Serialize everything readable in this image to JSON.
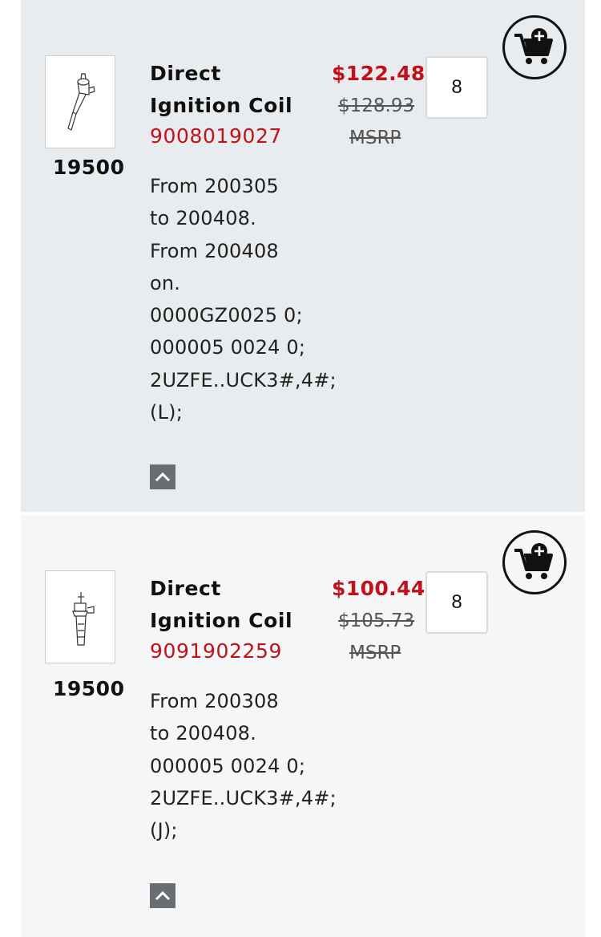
{
  "products": [
    {
      "callout": "19500",
      "name": "Direct Ignition Coil",
      "part_number": "9008019027",
      "price": "$122.48",
      "msrp_price": "$128.93",
      "msrp_label": "MSRP",
      "quantity": "8",
      "notes": [
        "From 200305",
        "to 200408.",
        "From 200408",
        "on.",
        "0000GZ0025 0;",
        "000005 0024 0;",
        "2UZFE..UCK3#,4#;",
        "(L);"
      ]
    },
    {
      "callout": "19500",
      "name": "Direct Ignition Coil",
      "part_number": "9091902259",
      "price": "$100.44",
      "msrp_price": "$105.73",
      "msrp_label": "MSRP",
      "quantity": "8",
      "notes": [
        "From 200308",
        "to 200408.",
        "000005 0024 0;",
        "2UZFE..UCK3#,4#;",
        "(J);"
      ]
    }
  ],
  "colors": {
    "accent_red": "#c0121a",
    "card_bg_1": "#e9ecee",
    "card_bg_2": "#f5f6f8",
    "collapse_bg": "#6b6e71"
  },
  "icons": {
    "cart": "cart-add-icon",
    "collapse": "chevron-up-icon",
    "thumbnail": "ignition-coil-diagram"
  }
}
